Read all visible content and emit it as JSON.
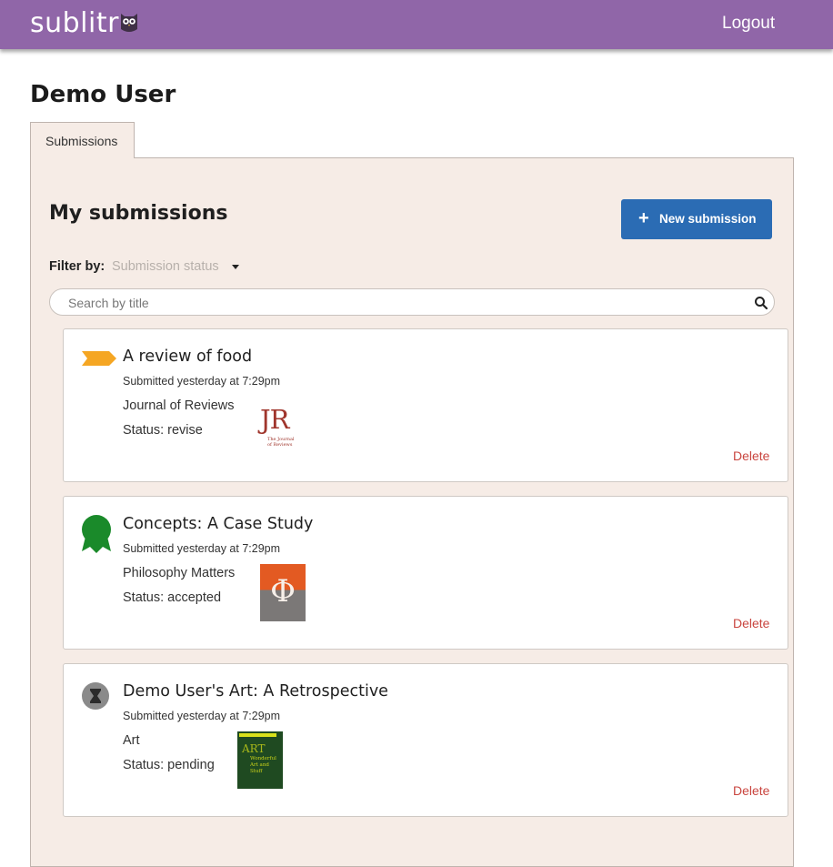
{
  "header": {
    "brand": "sublitr",
    "logout_label": "Logout"
  },
  "user": {
    "name": "Demo User"
  },
  "tabs": [
    {
      "label": "Submissions",
      "active": true
    }
  ],
  "submissions_panel": {
    "title": "My submissions",
    "new_submission_label": "New submission",
    "filter_label": "Filter by:",
    "filter_placeholder": "Submission status",
    "search_placeholder": "Search by title"
  },
  "submissions": [
    {
      "title": "A review of food",
      "submitted": "Submitted yesterday at 7:29pm",
      "journal": "Journal of Reviews",
      "status": "Status: revise",
      "status_icon": "revise-tag-icon",
      "cover": {
        "letters": "JR",
        "subtitle_lines": [
          "The Journal",
          "of Reviews"
        ]
      },
      "delete_label": "Delete"
    },
    {
      "title": "Concepts: A Case Study",
      "submitted": "Submitted yesterday at 7:29pm",
      "journal": "Philosophy Matters",
      "status": "Status: accepted",
      "status_icon": "award-ribbon-icon",
      "cover": {
        "letters": "Φ"
      },
      "delete_label": "Delete"
    },
    {
      "title": "Demo User's Art: A Retrospective",
      "submitted": "Submitted yesterday at 7:29pm",
      "journal": "Art",
      "status": "Status: pending",
      "status_icon": "hourglass-icon",
      "cover": {
        "letters": "ART",
        "subtitle_lines": [
          "Wonderful",
          "Art and Stuff"
        ]
      },
      "delete_label": "Delete"
    }
  ],
  "colors": {
    "header": "#9066a8",
    "panel": "#f6ece6",
    "primary_button": "#2b6cb4",
    "delete": "#c9453f",
    "revise": "#f5a623",
    "accepted": "#1a8a2a",
    "pending": "#8a8a8a"
  }
}
